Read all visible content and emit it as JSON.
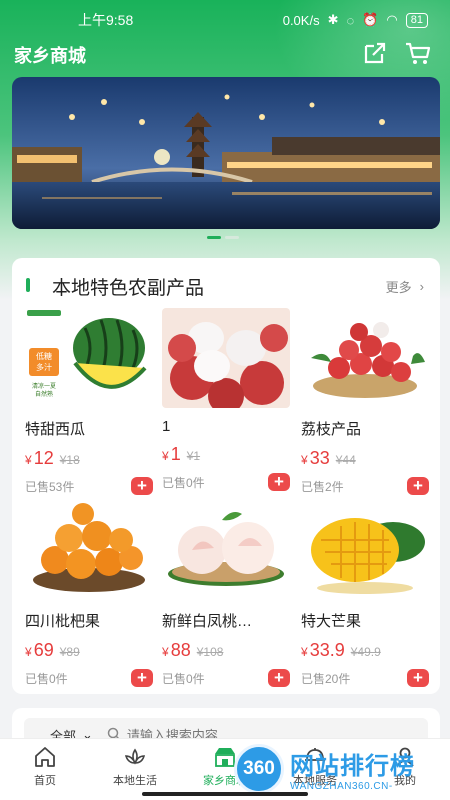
{
  "status": {
    "time": "上午9:58",
    "network_speed": "0.0K/s",
    "battery": "81"
  },
  "app": {
    "title": "家乡商城"
  },
  "banner": {
    "slide_index": 1,
    "slide_count": 2
  },
  "section": {
    "title": "本地特色农副产品",
    "more_label": "更多"
  },
  "currency": "¥",
  "products": [
    {
      "name": "特甜西瓜",
      "price": "12",
      "old_price": "¥18",
      "sold": "已售53件",
      "add_label": "+"
    },
    {
      "name": "1",
      "price": "1",
      "old_price": "¥1",
      "sold": "已售0件",
      "add_label": "+"
    },
    {
      "name": "荔枝产品",
      "price": "33",
      "old_price": "¥44",
      "sold": "已售2件",
      "add_label": "+"
    },
    {
      "name": "四川枇杷果",
      "price": "69",
      "old_price": "¥89",
      "sold": "已售0件",
      "add_label": "+"
    },
    {
      "name": "新鲜白凤桃…",
      "price": "88",
      "old_price": "¥108",
      "sold": "已售0件",
      "add_label": "+"
    },
    {
      "name": "特大芒果",
      "price": "33.9",
      "old_price": "¥49.9",
      "sold": "已售20件",
      "add_label": "+"
    }
  ],
  "watermelon_badge": {
    "line1": "低糖",
    "line2": "多汁",
    "line3": "清凉一夏",
    "line4": "自然熟"
  },
  "search": {
    "filter_label": "全部",
    "placeholder": "请输入搜索内容"
  },
  "nav": [
    {
      "label": "首页",
      "icon": "home-icon"
    },
    {
      "label": "本地生活",
      "icon": "lotus-icon"
    },
    {
      "label": "家乡商城",
      "icon": "shop-icon",
      "active": true
    },
    {
      "label": "本地服务",
      "icon": "service-icon"
    },
    {
      "label": "我的",
      "icon": "user-icon"
    }
  ],
  "watermark": {
    "logo": "360",
    "title": "网站排行榜",
    "subtitle": "WANGZHAN360.CN-"
  },
  "colors": {
    "brand_green": "#1fae5a",
    "price_red": "#e63c3c",
    "add_button": "#ec4a4a"
  }
}
